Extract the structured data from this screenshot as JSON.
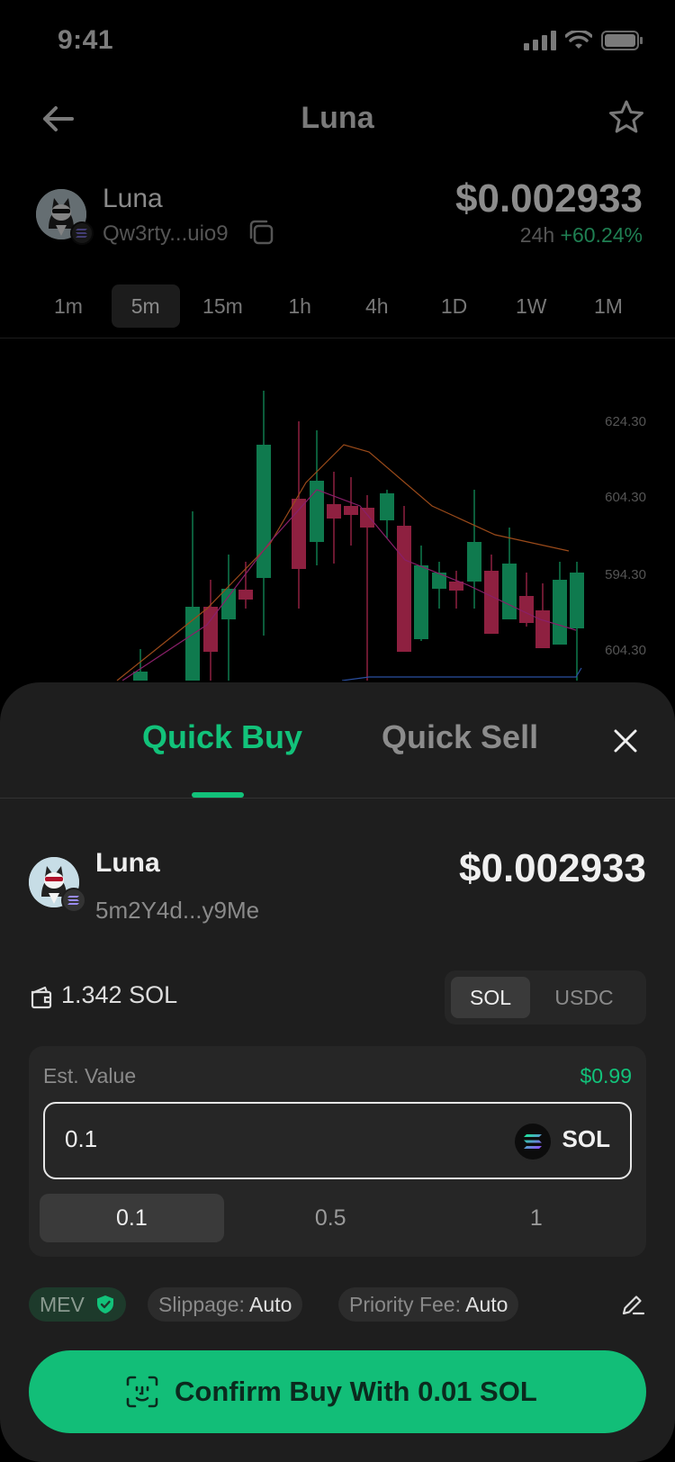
{
  "status": {
    "time": "9:41"
  },
  "header": {
    "title": "Luna"
  },
  "token": {
    "name": "Luna",
    "address": "Qw3rty...uio9",
    "price": "$0.002933",
    "change_label": "24h",
    "change_pct": "+60.24%"
  },
  "timeframes": [
    "1m",
    "5m",
    "15m",
    "1h",
    "4h",
    "1D",
    "1W",
    "1M"
  ],
  "active_timeframe": "5m",
  "chart": {
    "y_labels": [
      "624.30",
      "604.30",
      "594.30",
      "604.30"
    ]
  },
  "chart_data": {
    "type": "candlestick",
    "right_axis_labels": [
      "624.30",
      "604.30",
      "594.30",
      "604.30"
    ],
    "note_colors": {
      "up": "#0f7a4e",
      "down": "#8e2040"
    }
  },
  "sheet": {
    "tabs": {
      "buy": "Quick Buy",
      "sell": "Quick Sell"
    },
    "active_tab": "Quick Buy",
    "token": {
      "name": "Luna",
      "address": "5m2Y4d...y9Me",
      "price": "$0.002933"
    },
    "balance": "1.342 SOL",
    "currency_options": [
      "SOL",
      "USDC"
    ],
    "active_currency": "SOL",
    "est_label": "Est. Value",
    "est_value": "$0.99",
    "input_value": "0.1",
    "input_currency": "SOL",
    "presets": [
      "0.1",
      "0.5",
      "1"
    ],
    "active_preset": "0.1",
    "mev_label": "MEV",
    "slippage_label": "Slippage:",
    "slippage_value": "Auto",
    "priority_label": "Priority Fee:",
    "priority_value": "Auto",
    "confirm_label": "Confirm Buy With 0.01 SOL"
  },
  "colors": {
    "accent": "#12c27a",
    "sheet_bg": "#1e1e1e",
    "up": "#0f7a4e",
    "down": "#8e2040"
  }
}
